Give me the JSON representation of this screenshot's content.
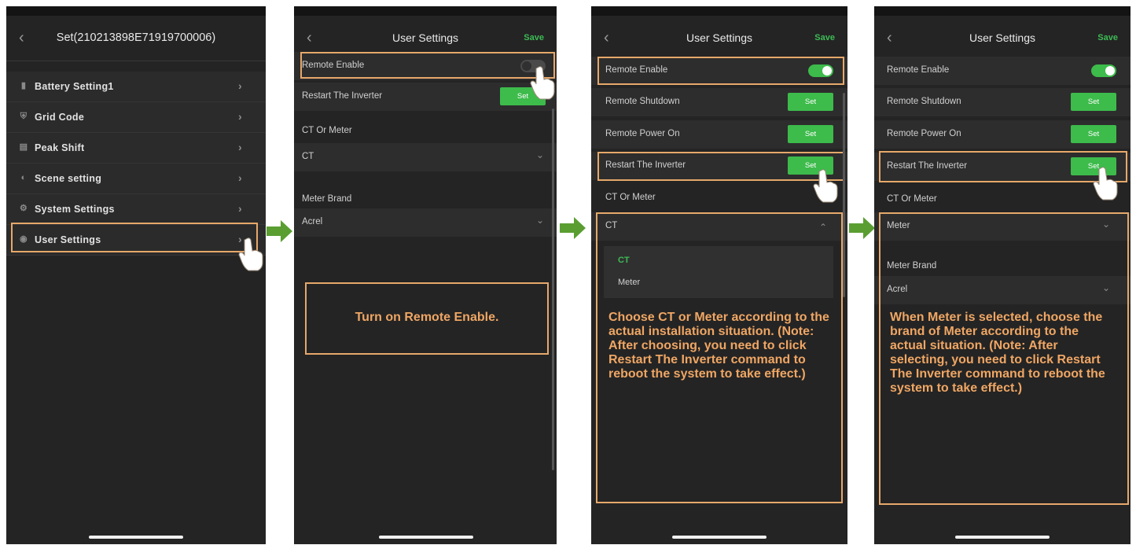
{
  "colors": {
    "accent": "#3dbb4b",
    "highlight": "#e6a86a",
    "caption": "#efa664",
    "screen_bg": "#242424"
  },
  "screen1": {
    "title": "Set(210213898E71919700006)",
    "menu": [
      {
        "label": "Battery Setting1",
        "icon": "battery-icon"
      },
      {
        "label": "Grid Code",
        "icon": "shield-icon"
      },
      {
        "label": "Peak Shift",
        "icon": "chart-icon"
      },
      {
        "label": "Scene setting",
        "icon": "scene-icon"
      },
      {
        "label": "System Settings",
        "icon": "gear-icon"
      },
      {
        "label": "User Settings",
        "icon": "user-settings-icon"
      }
    ]
  },
  "screen2": {
    "title": "User Settings",
    "save": "Save",
    "remote_enable": "Remote Enable",
    "restart": "Restart The Inverter",
    "set": "Set",
    "ct_or_meter_label": "CT Or Meter",
    "ct_value": "CT",
    "meter_brand_label": "Meter Brand",
    "meter_brand_value": "Acrel",
    "caption": "Turn on Remote Enable."
  },
  "screen3": {
    "title": "User Settings",
    "save": "Save",
    "remote_enable": "Remote Enable",
    "remote_shutdown": "Remote Shutdown",
    "remote_power_on": "Remote Power On",
    "restart": "Restart The Inverter",
    "set": "Set",
    "ct_or_meter_label": "CT Or Meter",
    "ct_value": "CT",
    "options": [
      "CT",
      "Meter"
    ],
    "caption": "Choose CT or Meter according to the actual installation situation. (Note: After choosing, you need to click Restart The Inverter command to reboot the system to take effect.)"
  },
  "screen4": {
    "title": "User Settings",
    "save": "Save",
    "remote_enable": "Remote Enable",
    "remote_shutdown": "Remote Shutdown",
    "remote_power_on": "Remote Power On",
    "restart": "Restart The Inverter",
    "set": "Set",
    "ct_or_meter_label": "CT Or Meter",
    "ct_value": "Meter",
    "meter_brand_label": "Meter Brand",
    "meter_brand_value": "Acrel",
    "caption": "When Meter is selected, choose the brand of Meter according to the actual situation. (Note: After selecting, you need to click Restart The Inverter command to reboot the system to take effect.)"
  }
}
